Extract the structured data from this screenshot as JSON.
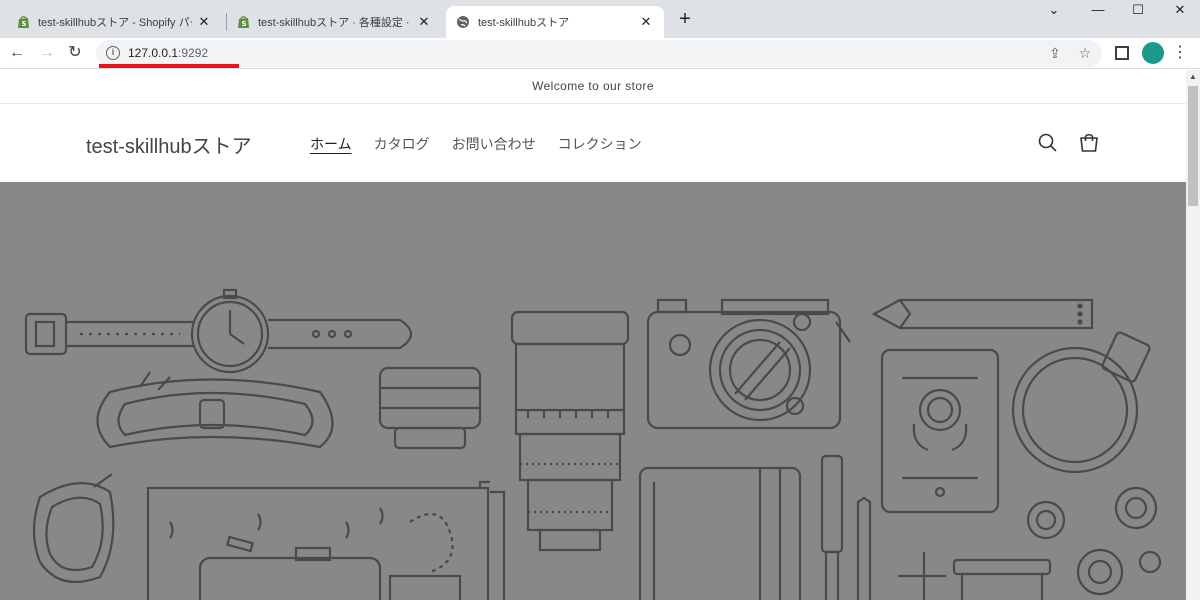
{
  "browser": {
    "tabs": [
      {
        "title": "test-skillhubストア - Shopify パート",
        "icon": "shopify-icon"
      },
      {
        "title": "test-skillhubストア · 各種設定 · Sho",
        "icon": "shopify-icon"
      },
      {
        "title": "test-skillhubストア",
        "icon": "globe-icon",
        "active": true
      }
    ],
    "new_tab": "+",
    "url_host": "127.0.0.1",
    "url_port": ":9292",
    "accent_underline_color": "#e8141b"
  },
  "store": {
    "announcement": "Welcome to our store",
    "logo": "test-skillhubストア",
    "nav": [
      {
        "label": "ホーム",
        "current": true
      },
      {
        "label": "カタログ"
      },
      {
        "label": "お問い合わせ"
      },
      {
        "label": "コレクション"
      }
    ],
    "hero_background": "#888888"
  }
}
